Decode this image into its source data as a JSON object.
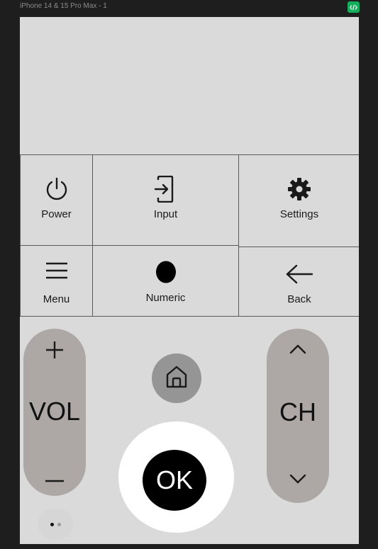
{
  "frame": {
    "title": "iPhone 14 & 15 Pro Max - 1"
  },
  "buttons": {
    "power": {
      "label": "Power",
      "icon": "power-icon"
    },
    "input": {
      "label": "Input",
      "icon": "input-icon"
    },
    "settings": {
      "label": "Settings",
      "icon": "gear-icon"
    },
    "menu": {
      "label": "Menu",
      "icon": "hamburger-icon"
    },
    "numeric": {
      "label": "Numeric",
      "icon": "dot-icon"
    },
    "back": {
      "label": "Back",
      "icon": "arrow-left-icon"
    }
  },
  "volume": {
    "label": "VOL",
    "up_icon": "plus-icon",
    "down_icon": "minus-icon"
  },
  "channel": {
    "label": "CH",
    "up_icon": "chevron-up-icon",
    "down_icon": "chevron-down-icon"
  },
  "home": {
    "icon": "home-icon"
  },
  "ok": {
    "label": "OK"
  },
  "pager": {
    "pages": 2,
    "current": 1
  },
  "colors": {
    "background": "#dadada",
    "pill": "#ada7a5",
    "home": "#959595",
    "ok": "#000000",
    "badge": "#14ae5c"
  }
}
